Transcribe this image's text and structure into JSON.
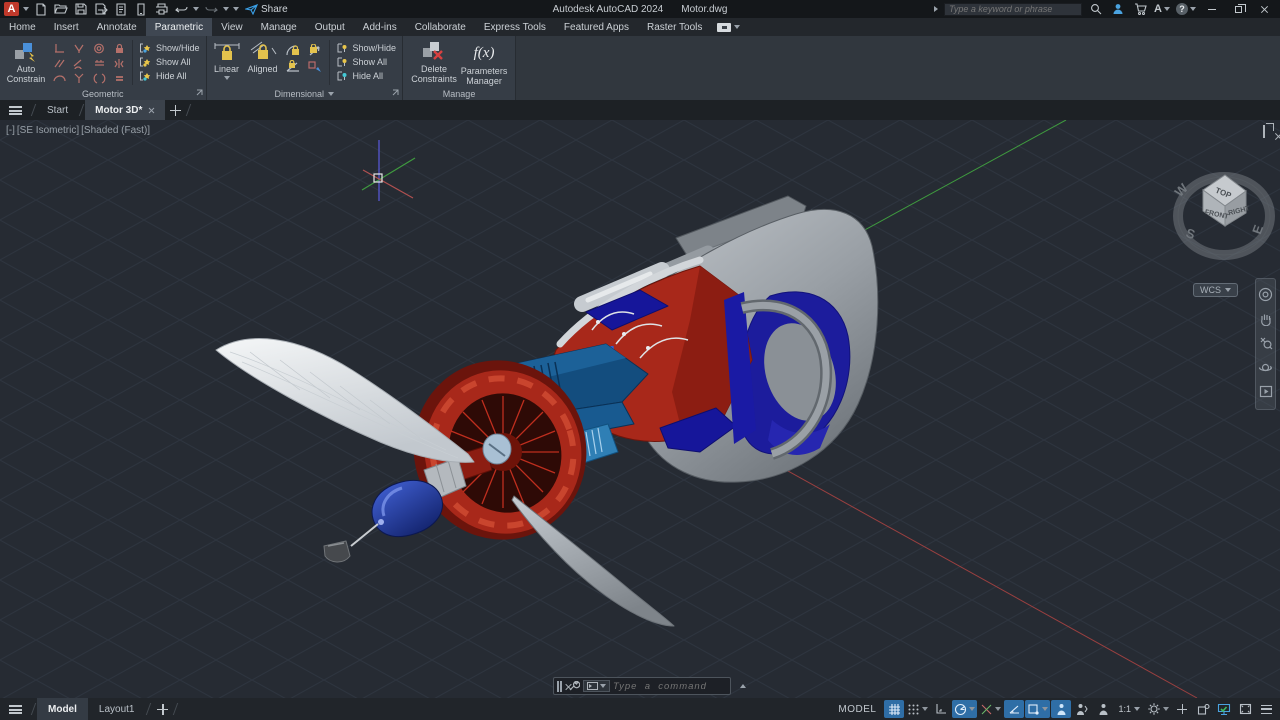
{
  "titlebar": {
    "logo_letter": "A",
    "app_title": "Autodesk AutoCAD 2024",
    "doc_title": "Motor.dwg",
    "share": "Share",
    "search_placeholder": "Type a keyword or phrase",
    "appstore_letter": "A",
    "help_label": "?"
  },
  "ribbon": {
    "tabs": [
      {
        "label": "Home"
      },
      {
        "label": "Insert"
      },
      {
        "label": "Annotate"
      },
      {
        "label": "Parametric"
      },
      {
        "label": "View"
      },
      {
        "label": "Manage"
      },
      {
        "label": "Output"
      },
      {
        "label": "Add-ins"
      },
      {
        "label": "Collaborate"
      },
      {
        "label": "Express Tools"
      },
      {
        "label": "Featured Apps"
      },
      {
        "label": "Raster Tools"
      }
    ],
    "active_tab": "Parametric",
    "geometric": {
      "title": "Geometric",
      "auto_constrain": "Auto Constrain",
      "show_hide": "Show/Hide",
      "show_all": "Show All",
      "hide_all": "Hide All"
    },
    "dimensional": {
      "title": "Dimensional",
      "linear": "Linear",
      "aligned": "Aligned",
      "show_hide": "Show/Hide",
      "show_all": "Show All",
      "hide_all": "Hide All"
    },
    "manage": {
      "title": "Manage",
      "delete_constraints": "Delete Constraints",
      "parameters_manager": "Parameters Manager",
      "fx": "f(x)"
    }
  },
  "file_tabs": {
    "start": "Start",
    "active_doc": "Motor 3D*"
  },
  "viewport": {
    "controls": {
      "expand": "[-]",
      "view": "[SE Isometric]",
      "style": "[Shaded (Fast)]"
    },
    "viewcube": {
      "top": "TOP",
      "front": "FRONT",
      "right": "RIGHT",
      "west": "W",
      "south": "S",
      "east": "E",
      "wcs": "WCS"
    }
  },
  "command_line": {
    "placeholder": "Type  a  command"
  },
  "status_bar": {
    "model_tab": "Model",
    "layout_tab": "Layout1",
    "model_label": "MODEL",
    "annotation_scale": "1:1",
    "toggles": [
      {
        "name": "grid",
        "active": true
      },
      {
        "name": "snap-mode",
        "active": false
      },
      {
        "name": "ortho",
        "active": false
      },
      {
        "name": "polar-tracking",
        "active": true
      },
      {
        "name": "isometric-drafting",
        "active": false
      },
      {
        "name": "object-snap-tracking",
        "active": true
      },
      {
        "name": "object-snap",
        "active": true
      },
      {
        "name": "annotation-visibility",
        "active": true
      },
      {
        "name": "autoscale",
        "active": false
      },
      {
        "name": "annotation-scale",
        "active": false
      },
      {
        "name": "workspace",
        "active": false
      },
      {
        "name": "lock-ui",
        "active": false
      },
      {
        "name": "isolate-objects",
        "active": false
      },
      {
        "name": "graphics-performance",
        "active": false
      },
      {
        "name": "clean-screen",
        "active": false
      },
      {
        "name": "customization",
        "active": false
      }
    ]
  },
  "colors": {
    "accent_blue": "#2f6ea6",
    "viewport_bg": "#262b33",
    "ribbon_bg": "#363d46",
    "constraint_red": "#b5706a",
    "lock_yellow": "#e3c24d",
    "axis_green": "#3f9b3f",
    "axis_red": "#9b4040"
  }
}
